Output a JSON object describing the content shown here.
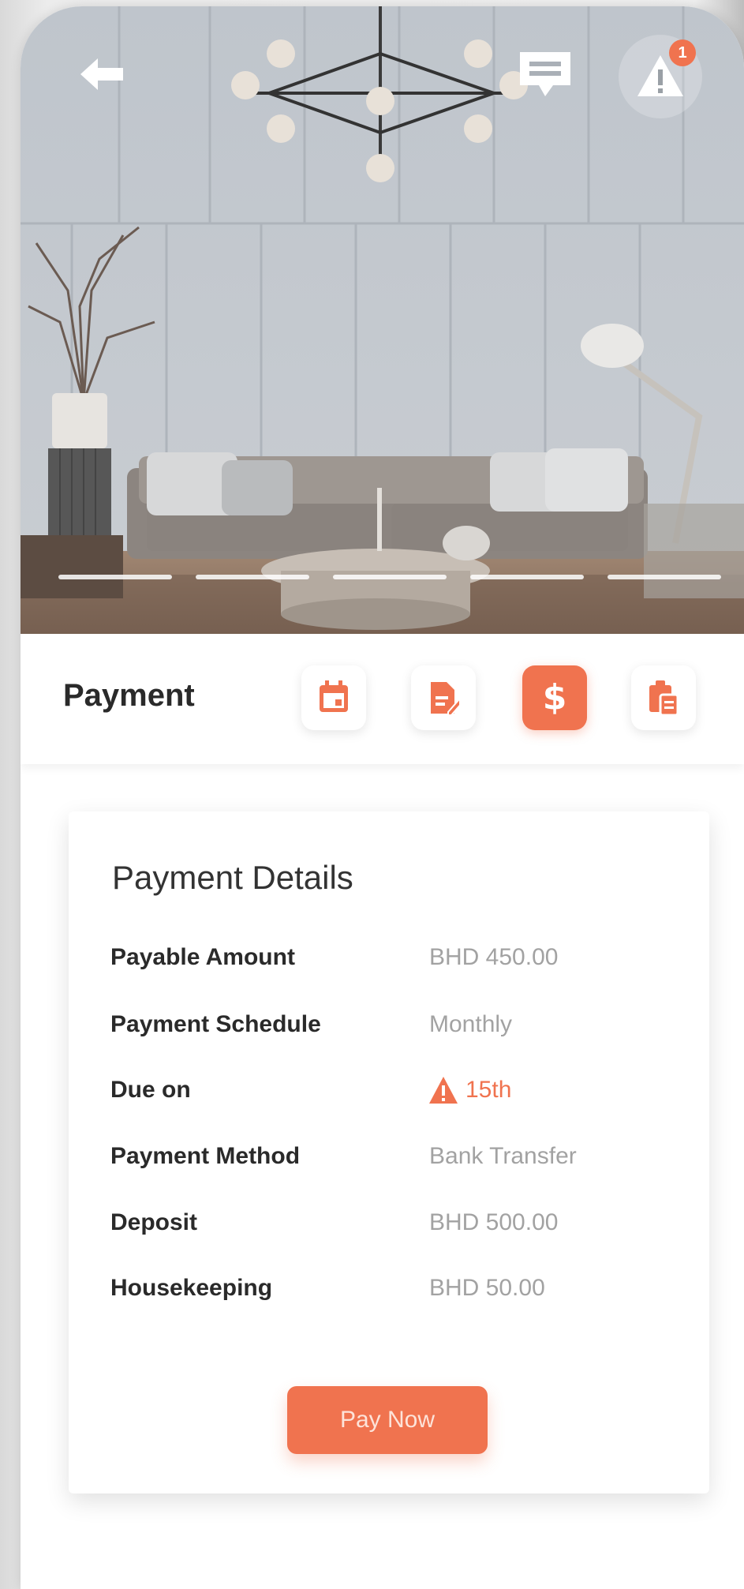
{
  "header": {
    "back_icon": "arrow-left-icon",
    "message_icon": "chat-icon",
    "alert_icon": "warning-icon",
    "alert_badge_count": "1"
  },
  "hero": {
    "image_description_icon": "living-room-photo",
    "carousel_pages": 5
  },
  "section": {
    "title": "Payment",
    "tabs": [
      {
        "name": "calendar",
        "icon": "calendar-icon",
        "active": false
      },
      {
        "name": "document-edit",
        "icon": "document-edit-icon",
        "active": false
      },
      {
        "name": "payment",
        "icon": "dollar-icon",
        "symbol": "$",
        "active": true
      },
      {
        "name": "clipboard",
        "icon": "clipboard-icon",
        "active": false
      }
    ]
  },
  "details": {
    "title": "Payment Details",
    "rows": [
      {
        "label": "Payable Amount",
        "value": "BHD 450.00"
      },
      {
        "label": "Payment Schedule",
        "value": "Monthly"
      },
      {
        "label": "Due on",
        "value": "15th",
        "status": "warning"
      },
      {
        "label": "Payment Method",
        "value": "Bank Transfer"
      },
      {
        "label": "Deposit",
        "value": "BHD 500.00"
      },
      {
        "label": "Housekeeping",
        "value": "BHD 50.00"
      }
    ],
    "pay_button": "Pay Now"
  },
  "colors": {
    "accent": "#f0734f",
    "label_text": "#2a2a2a",
    "value_text": "#a2a2a2"
  }
}
